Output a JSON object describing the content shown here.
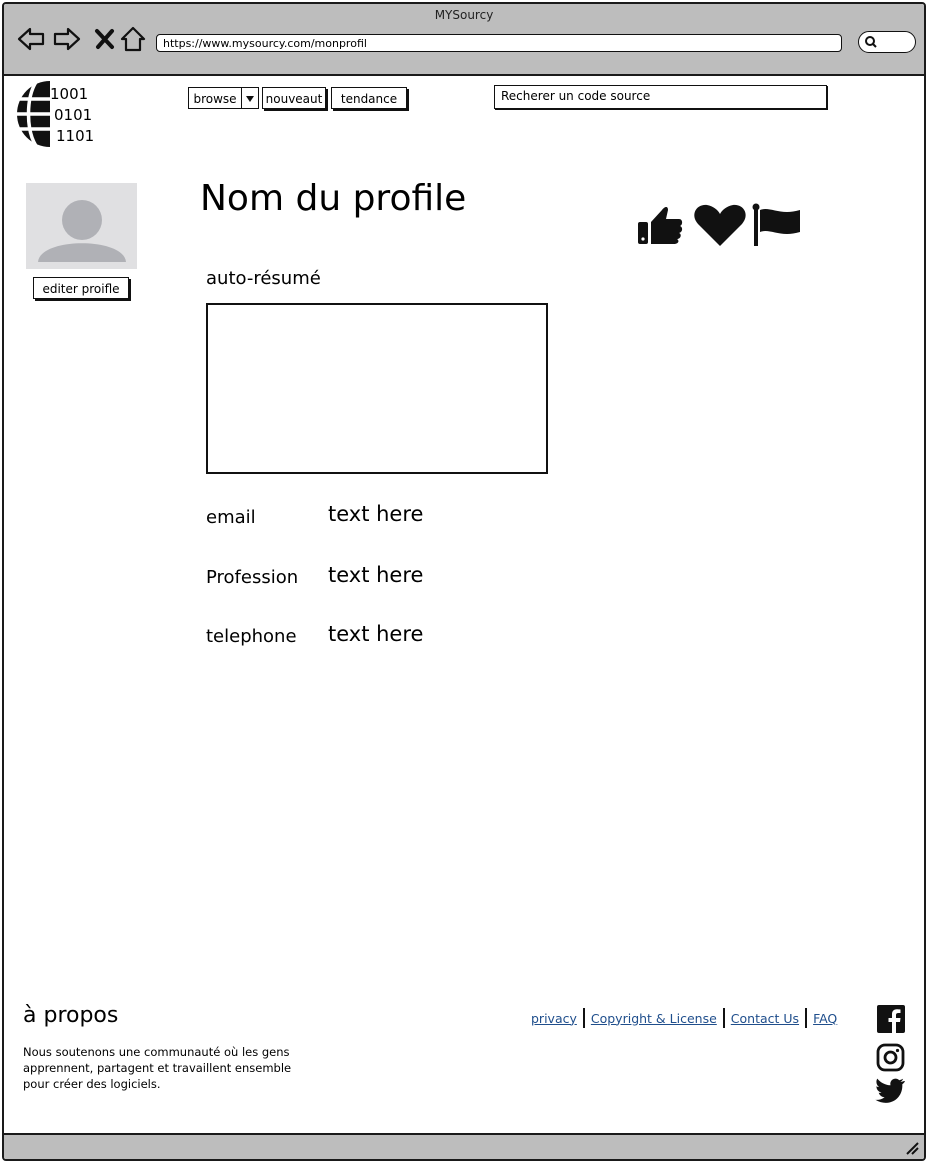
{
  "browser": {
    "window_title": "MYSourcy",
    "url": "https://www.mysourcy.com/monprofil"
  },
  "header": {
    "logo_bits": [
      "1001",
      "0101",
      "1101"
    ],
    "nav": {
      "browse_label": "browse",
      "nouveaut_label": "nouveaut",
      "tendance_label": "tendance"
    },
    "search_placeholder": "Recherer un  code source"
  },
  "profile": {
    "edit_label": "editer proifle",
    "name": "Nom du profile",
    "bio_label": "auto-résumé",
    "bio_value": "",
    "fields": [
      {
        "label": "email",
        "value": "text here"
      },
      {
        "label": "Profession",
        "value": "text here"
      },
      {
        "label": "telephone",
        "value": "text here"
      }
    ],
    "action_icons": [
      "thumbs-up-icon",
      "heart-icon",
      "flag-icon"
    ]
  },
  "footer": {
    "about_title": "à propos",
    "about_text": "Nous soutenons une communauté où les gens apprennent, partagent et travaillent ensemble pour créer des logiciels.",
    "links": [
      "privacy",
      "Copyright & License",
      "Contact Us",
      "FAQ"
    ],
    "social_icons": [
      "facebook-icon",
      "instagram-icon",
      "twitter-icon"
    ]
  },
  "colors": {
    "chrome": "#bdbdbd",
    "link": "#1f4e8c",
    "avatar_bg": "#e0e0e2",
    "avatar_fg": "#b0b1b6"
  }
}
